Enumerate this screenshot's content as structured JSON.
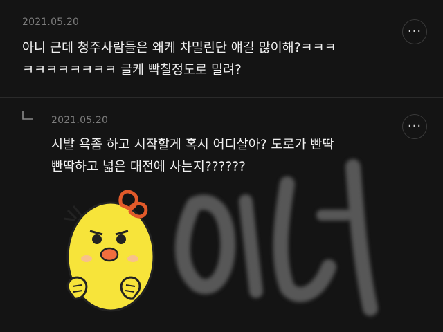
{
  "comments": [
    {
      "date": "2021.05.20",
      "lines": [
        "아니 근데 청주사람들은 왜케 차밀린단 얘길 많이해?ㅋㅋㅋ",
        "ㅋㅋㅋㅋㅋㅋㅋㅋ 글케 빡칠정도로 밀려?"
      ],
      "more_label": "···"
    },
    {
      "date": "2021.05.20",
      "lines": [
        "시발 욕좀 하고 시작할게 혹시 어디살아? 도로가 빤딱",
        "빤딱하고 넓은 대전에 사는지??????"
      ],
      "more_label": "···",
      "is_reply": true
    }
  ],
  "sticker": {
    "description_icon": "angry-chick-sticker-icon"
  },
  "colors": {
    "background": "#141414",
    "text": "#f0f0f0",
    "date": "#7d7d7d",
    "divider": "#2a2a2a"
  }
}
